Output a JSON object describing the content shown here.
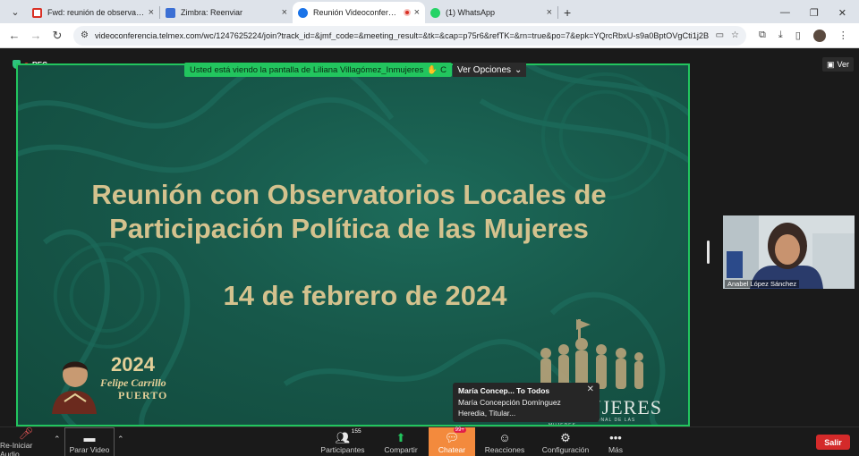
{
  "browser": {
    "tabs": [
      {
        "title": "Fwd: reunión de observatorio",
        "favicon_color": "#d93025",
        "active": false
      },
      {
        "title": "Zimbra: Reenviar",
        "favicon_color": "#3b6fd4",
        "active": false
      },
      {
        "title": "Reunión Videoconferencia",
        "favicon_color": "#1a73e8",
        "active": true,
        "recording": true
      },
      {
        "title": "(1) WhatsApp",
        "favicon_color": "#25d366",
        "active": false
      }
    ],
    "url": "videoconferencia.telmex.com/wc/1247625224/join?track_id=&jmf_code=&meeting_result=&tk=&cap=p75r6&refTK=&rn=true&po=7&epk=YQrcRbxU-s9a0BptOVgCti1j2BIqQs..."
  },
  "meeting": {
    "rec_label": "REC",
    "share_banner": "Usted está viendo la pantalla de Liliana Villagómez_Inmujeres",
    "options_label": "Ver Opciones",
    "view_label": "Ver",
    "slide": {
      "title_line1": "Reunión con Observatorios Locales de",
      "title_line2": "Participación Política de las Mujeres",
      "date": "14 de febrero de 2024",
      "logo_year": "2024",
      "logo_name": "Felipe Carrillo",
      "logo_puerto": "PUERTO",
      "inmujeres_text": "INMUJERES",
      "inmujeres_sub": "INSTITUTO NACIONAL DE LAS MUJERES"
    },
    "chat_popup": {
      "from": "María Concep... To Todos",
      "message_line1": "María Concepción Domínguez",
      "message_line2": "Heredia, Titular..."
    },
    "participant": {
      "name": "Anabel López Sánchez"
    }
  },
  "toolbar": {
    "audio_label": "Re-Iniciar Audio",
    "video_label": "Parar Video",
    "participants_label": "Participantes",
    "participants_count": "155",
    "share_label": "Compartir",
    "chat_label": "Chatear",
    "chat_badge": "99+",
    "reactions_label": "Reacciones",
    "settings_label": "Configuración",
    "more_label": "Más",
    "leave_label": "Salir"
  },
  "colors": {
    "share_green": "#22c55e",
    "slide_gold": "#d4c28e",
    "chat_orange": "#f38a3d",
    "leave_red": "#d42a2a"
  }
}
